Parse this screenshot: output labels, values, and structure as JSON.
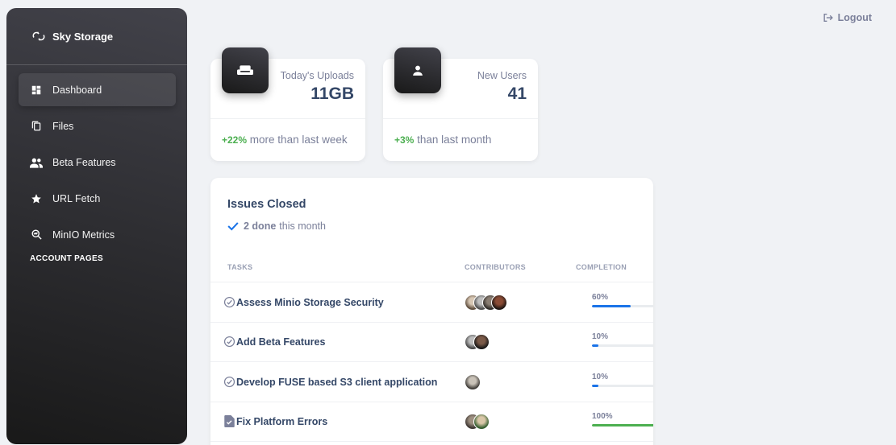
{
  "sidebar": {
    "brand": "Sky Storage",
    "items": [
      {
        "label": "Dashboard",
        "icon": "dashboard-icon",
        "active": true
      },
      {
        "label": "Files",
        "icon": "files-icon",
        "active": false
      },
      {
        "label": "Beta Features",
        "icon": "people-icon",
        "active": false
      },
      {
        "label": "URL Fetch",
        "icon": "star-icon",
        "active": false
      },
      {
        "label": "MinIO Metrics",
        "icon": "query-stats-icon",
        "active": false
      }
    ],
    "section_label": "ACCOUNT PAGES"
  },
  "header": {
    "logout_label": "Logout"
  },
  "stats": [
    {
      "label": "Today's Uploads",
      "value": "11GB",
      "change": "+22%",
      "change_text": "more than last week",
      "icon": "weekend-icon"
    },
    {
      "label": "New Users",
      "value": "41",
      "change": "+3%",
      "change_text": "than last month",
      "icon": "person-icon"
    }
  ],
  "issues": {
    "title": "Issues Closed",
    "done_count": "2 done",
    "done_suffix": "this month",
    "columns": [
      "TASKS",
      "CONTRIBUTORS",
      "COMPLETION"
    ],
    "rows": [
      {
        "task": "Assess Minio Storage Security",
        "icon": "check-circle-icon",
        "contributors": 4,
        "completion_label": "60%",
        "completion": 60
      },
      {
        "task": "Add Beta Features",
        "icon": "check-circle-icon",
        "contributors": 2,
        "completion_label": "10%",
        "completion": 10
      },
      {
        "task": "Develop FUSE based S3 client application",
        "icon": "check-circle-icon",
        "contributors": 1,
        "completion_label": "10%",
        "completion": 10
      },
      {
        "task": "Fix Platform Errors",
        "icon": "document-check-icon",
        "contributors": 2,
        "completion_label": "100%",
        "completion": 100
      }
    ]
  },
  "colors": {
    "accent_blue": "#1a73e8",
    "success_green": "#4caf50",
    "sidebar_dark": "#191919"
  }
}
